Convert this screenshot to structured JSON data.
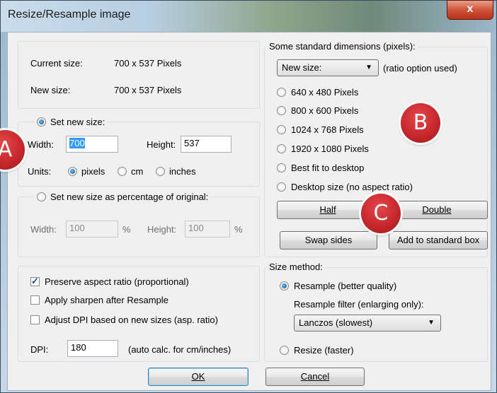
{
  "window": {
    "title": "Resize/Resample image",
    "close_label": "x"
  },
  "size_info": {
    "current_label": "Current size:",
    "current_value": "700  x  537  Pixels",
    "new_label": "New size:",
    "new_value": "700  x  537  Pixels"
  },
  "set_new_size": {
    "option_label": "Set new size:",
    "selected": true,
    "width_label": "Width:",
    "width_value": "700",
    "height_label": "Height:",
    "height_value": "537",
    "units_label": "Units:",
    "units": [
      {
        "label": "pixels",
        "selected": true
      },
      {
        "label": "cm",
        "selected": false
      },
      {
        "label": "inches",
        "selected": false
      }
    ]
  },
  "percentage": {
    "option_label": "Set new size as percentage of original:",
    "selected": false,
    "width_label": "Width:",
    "width_value": "100",
    "width_unit": "%",
    "height_label": "Height:",
    "height_value": "100",
    "height_unit": "%"
  },
  "options": {
    "preserve_aspect": {
      "label": "Preserve aspect ratio (proportional)",
      "checked": true
    },
    "sharpen": {
      "label": "Apply sharpen after Resample",
      "checked": false
    },
    "adjust_dpi": {
      "label": "Adjust DPI based on new sizes (asp. ratio)",
      "checked": false
    },
    "dpi_label": "DPI:",
    "dpi_value": "180",
    "dpi_note": "(auto calc. for cm/inches)"
  },
  "standard": {
    "legend": "Some standard dimensions (pixels):",
    "select_value": "New size:",
    "ratio_note": "(ratio option used)",
    "presets": [
      {
        "label": "640 x 480 Pixels"
      },
      {
        "label": "800 x 600 Pixels"
      },
      {
        "label": "1024 x 768 Pixels"
      },
      {
        "label": "1920 x 1080 Pixels"
      },
      {
        "label": "Best fit to desktop"
      },
      {
        "label": "Desktop size (no aspect ratio)"
      }
    ],
    "half_label": "Half",
    "double_label": "Double",
    "swap_label": "Swap sides",
    "add_label": "Add to standard box"
  },
  "method": {
    "legend": "Size method:",
    "resample_label": "Resample (better quality)",
    "resample_selected": true,
    "filter_label": "Resample filter (enlarging only):",
    "filter_value": "Lanczos (slowest)",
    "resize_label": "Resize (faster)",
    "resize_selected": false
  },
  "footer": {
    "ok_label": "OK",
    "cancel_label": "Cancel"
  },
  "annotations": {
    "a": "A",
    "b": "B",
    "c": "C"
  },
  "colors": {
    "badge": "#c6282c",
    "selection": "#3399ff"
  }
}
